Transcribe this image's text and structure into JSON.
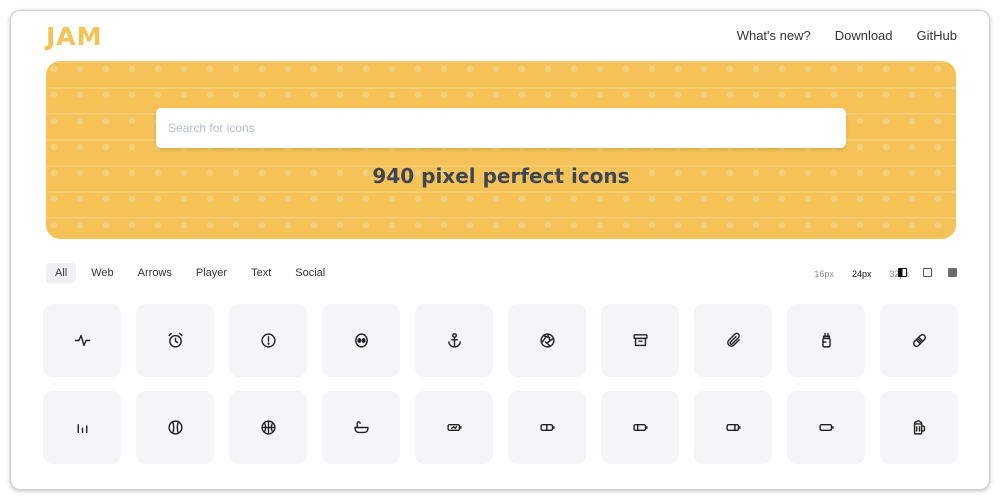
{
  "header": {
    "logo": "JAM",
    "nav": [
      "What's new?",
      "Download",
      "GitHub"
    ]
  },
  "hero": {
    "search_placeholder": "Search for icons",
    "headline": "940 pixel perfect icons"
  },
  "tabs": [
    "All",
    "Web",
    "Arrows",
    "Player",
    "Text",
    "Social"
  ],
  "active_tab": "All",
  "sizes": [
    "16px",
    "24px",
    "32px"
  ],
  "selected_size": "24px",
  "style_modes": [
    "half-filled",
    "outline",
    "filled"
  ],
  "colors": {
    "accent": "#f4c257",
    "tile_bg": "#f3f5f6",
    "headline": "#3f4651"
  },
  "icons": [
    "activity-icon",
    "alarm-clock-icon",
    "alert-icon",
    "alien-icon",
    "anchor-icon",
    "aperture-icon",
    "archive-icon",
    "attachment-icon",
    "baby-bottle-icon",
    "bandage-icon",
    "bar-chart-icon",
    "baseball-icon",
    "basketball-icon",
    "bathtub-icon",
    "battery-charging-icon",
    "battery-half-icon",
    "battery-one-third-icon",
    "battery-two-thirds-icon",
    "battery-empty-icon",
    "beer-icon"
  ]
}
